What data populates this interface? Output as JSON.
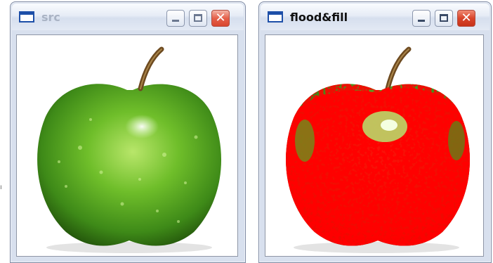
{
  "windows": {
    "src": {
      "title": "src"
    },
    "flood": {
      "title": "flood&fill"
    }
  },
  "controls": {
    "close_glyph": "✕"
  },
  "colors": {
    "apple_green": "#6fbe2a",
    "fill_red": "#ff0000",
    "titlebar": "#dfe6f2"
  },
  "icons": [
    "window-icon",
    "minimize-icon",
    "maximize-icon",
    "close-icon"
  ]
}
